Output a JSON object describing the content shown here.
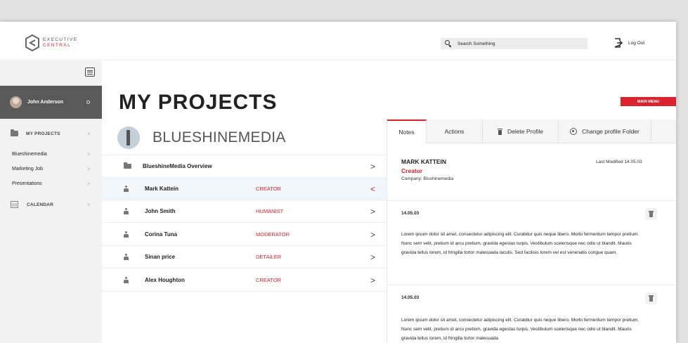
{
  "header": {
    "logo_line1": "EXECUTIVE",
    "logo_line2": "CENTRAL",
    "search_placeholder": "Search Something",
    "logout_label": "Log Out"
  },
  "sidebar": {
    "user_name": "John Anderson",
    "section_projects": "MY PROJECTS",
    "section_projects_action": "+",
    "items": [
      {
        "label": "Blueshinemedia"
      },
      {
        "label": "Marketing Job"
      },
      {
        "label": "Presentations"
      }
    ],
    "section_calendar": "CALENDAR"
  },
  "main": {
    "title": "MY PROJECTS",
    "main_menu_label": "MAIN MENU",
    "project_name": "BLUESHINEMEDIA",
    "overview_label": "BlueshineMedia Overview",
    "people": [
      {
        "name": "Mark Kattein",
        "role": "CREATOR"
      },
      {
        "name": "John Smith",
        "role": "HUMANIST"
      },
      {
        "name": "Corina Tuna",
        "role": "MODERATOR"
      },
      {
        "name": "Sinan price",
        "role": "DETAILER"
      },
      {
        "name": "Alex Houghton",
        "role": "CREATOR"
      }
    ]
  },
  "panel": {
    "tabs": [
      "Notes",
      "Actions",
      "Delete Profile",
      "Change profile Folder"
    ],
    "contact_name": "MARK KATTEIN",
    "contact_role": "Creator",
    "contact_company": "Company: Blushinemedia",
    "last_modified": "Last Modified 14.05.03",
    "notes": [
      {
        "date": "14.05.03",
        "text": "Lorem ipsum dolor sit amet, consectetur adipiscing elit. Curabitur quis neque libero. Morbi fermentum tempor pretium. Nunc sem velit, pretium id arcu pretium, gravida egestas turpis. Vestibulum scelerisque nec odio ut blandit. Mauris gravida tellus lorem, id fringilla tortor malesuada iaculis. Sed facilisis lorem vel est venenatis congue quam."
      },
      {
        "date": "14.05.03",
        "text": "Lorem ipsum dolor sit amet, consectetur adipiscing elit. Curabitur quis neque libero. Morbi fermentum tempor pretium. Nunc sem velit, pretium id arcu pretium, gravida egestas turpis. Vestibulum scelerisque nec odio ut blandit. Mauris gravida tellus lorem, id fringilla tortor malesuada"
      }
    ]
  },
  "colors": {
    "accent": "#d9232e",
    "sidebar_user_bg": "#595959",
    "sidebar_bg": "#f2f2f2"
  }
}
